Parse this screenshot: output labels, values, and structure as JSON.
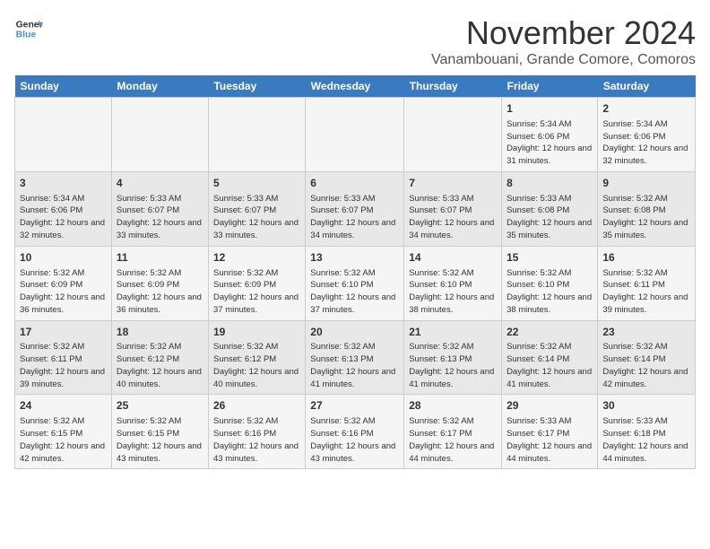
{
  "logo": {
    "line1": "General",
    "line2": "Blue"
  },
  "title": "November 2024",
  "subtitle": "Vanambouani, Grande Comore, Comoros",
  "days_header": [
    "Sunday",
    "Monday",
    "Tuesday",
    "Wednesday",
    "Thursday",
    "Friday",
    "Saturday"
  ],
  "weeks": [
    [
      {
        "day": "",
        "info": ""
      },
      {
        "day": "",
        "info": ""
      },
      {
        "day": "",
        "info": ""
      },
      {
        "day": "",
        "info": ""
      },
      {
        "day": "",
        "info": ""
      },
      {
        "day": "1",
        "info": "Sunrise: 5:34 AM\nSunset: 6:06 PM\nDaylight: 12 hours and 31 minutes."
      },
      {
        "day": "2",
        "info": "Sunrise: 5:34 AM\nSunset: 6:06 PM\nDaylight: 12 hours and 32 minutes."
      }
    ],
    [
      {
        "day": "3",
        "info": "Sunrise: 5:34 AM\nSunset: 6:06 PM\nDaylight: 12 hours and 32 minutes."
      },
      {
        "day": "4",
        "info": "Sunrise: 5:33 AM\nSunset: 6:07 PM\nDaylight: 12 hours and 33 minutes."
      },
      {
        "day": "5",
        "info": "Sunrise: 5:33 AM\nSunset: 6:07 PM\nDaylight: 12 hours and 33 minutes."
      },
      {
        "day": "6",
        "info": "Sunrise: 5:33 AM\nSunset: 6:07 PM\nDaylight: 12 hours and 34 minutes."
      },
      {
        "day": "7",
        "info": "Sunrise: 5:33 AM\nSunset: 6:07 PM\nDaylight: 12 hours and 34 minutes."
      },
      {
        "day": "8",
        "info": "Sunrise: 5:33 AM\nSunset: 6:08 PM\nDaylight: 12 hours and 35 minutes."
      },
      {
        "day": "9",
        "info": "Sunrise: 5:32 AM\nSunset: 6:08 PM\nDaylight: 12 hours and 35 minutes."
      }
    ],
    [
      {
        "day": "10",
        "info": "Sunrise: 5:32 AM\nSunset: 6:09 PM\nDaylight: 12 hours and 36 minutes."
      },
      {
        "day": "11",
        "info": "Sunrise: 5:32 AM\nSunset: 6:09 PM\nDaylight: 12 hours and 36 minutes."
      },
      {
        "day": "12",
        "info": "Sunrise: 5:32 AM\nSunset: 6:09 PM\nDaylight: 12 hours and 37 minutes."
      },
      {
        "day": "13",
        "info": "Sunrise: 5:32 AM\nSunset: 6:10 PM\nDaylight: 12 hours and 37 minutes."
      },
      {
        "day": "14",
        "info": "Sunrise: 5:32 AM\nSunset: 6:10 PM\nDaylight: 12 hours and 38 minutes."
      },
      {
        "day": "15",
        "info": "Sunrise: 5:32 AM\nSunset: 6:10 PM\nDaylight: 12 hours and 38 minutes."
      },
      {
        "day": "16",
        "info": "Sunrise: 5:32 AM\nSunset: 6:11 PM\nDaylight: 12 hours and 39 minutes."
      }
    ],
    [
      {
        "day": "17",
        "info": "Sunrise: 5:32 AM\nSunset: 6:11 PM\nDaylight: 12 hours and 39 minutes."
      },
      {
        "day": "18",
        "info": "Sunrise: 5:32 AM\nSunset: 6:12 PM\nDaylight: 12 hours and 40 minutes."
      },
      {
        "day": "19",
        "info": "Sunrise: 5:32 AM\nSunset: 6:12 PM\nDaylight: 12 hours and 40 minutes."
      },
      {
        "day": "20",
        "info": "Sunrise: 5:32 AM\nSunset: 6:13 PM\nDaylight: 12 hours and 41 minutes."
      },
      {
        "day": "21",
        "info": "Sunrise: 5:32 AM\nSunset: 6:13 PM\nDaylight: 12 hours and 41 minutes."
      },
      {
        "day": "22",
        "info": "Sunrise: 5:32 AM\nSunset: 6:14 PM\nDaylight: 12 hours and 41 minutes."
      },
      {
        "day": "23",
        "info": "Sunrise: 5:32 AM\nSunset: 6:14 PM\nDaylight: 12 hours and 42 minutes."
      }
    ],
    [
      {
        "day": "24",
        "info": "Sunrise: 5:32 AM\nSunset: 6:15 PM\nDaylight: 12 hours and 42 minutes."
      },
      {
        "day": "25",
        "info": "Sunrise: 5:32 AM\nSunset: 6:15 PM\nDaylight: 12 hours and 43 minutes."
      },
      {
        "day": "26",
        "info": "Sunrise: 5:32 AM\nSunset: 6:16 PM\nDaylight: 12 hours and 43 minutes."
      },
      {
        "day": "27",
        "info": "Sunrise: 5:32 AM\nSunset: 6:16 PM\nDaylight: 12 hours and 43 minutes."
      },
      {
        "day": "28",
        "info": "Sunrise: 5:32 AM\nSunset: 6:17 PM\nDaylight: 12 hours and 44 minutes."
      },
      {
        "day": "29",
        "info": "Sunrise: 5:33 AM\nSunset: 6:17 PM\nDaylight: 12 hours and 44 minutes."
      },
      {
        "day": "30",
        "info": "Sunrise: 5:33 AM\nSunset: 6:18 PM\nDaylight: 12 hours and 44 minutes."
      }
    ]
  ]
}
